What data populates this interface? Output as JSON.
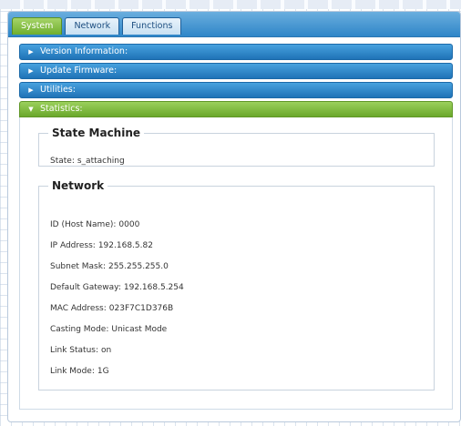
{
  "tabs": [
    {
      "label": "System",
      "active": true
    },
    {
      "label": "Network",
      "active": false
    },
    {
      "label": "Functions",
      "active": false
    }
  ],
  "accordion": [
    {
      "label": "Version Information:",
      "expanded": false,
      "icon": "triangle-right-icon"
    },
    {
      "label": "Update Firmware:",
      "expanded": false,
      "icon": "triangle-right-icon"
    },
    {
      "label": "Utilities:",
      "expanded": false,
      "icon": "triangle-right-icon"
    },
    {
      "label": "Statistics:",
      "expanded": true,
      "icon": "triangle-down-icon"
    }
  ],
  "statistics": {
    "state_machine": {
      "title": "State Machine",
      "state_label": "State:",
      "state_value": "s_attaching"
    },
    "network": {
      "title": "Network",
      "rows": [
        {
          "label": "ID (Host Name):",
          "value": "0000"
        },
        {
          "label": "IP Address:",
          "value": "192.168.5.82"
        },
        {
          "label": "Subnet Mask:",
          "value": "255.255.255.0"
        },
        {
          "label": "Default Gateway:",
          "value": "192.168.5.254"
        },
        {
          "label": "MAC Address:",
          "value": "023F7C1D376B"
        },
        {
          "label": "Casting Mode:",
          "value": "Unicast Mode"
        },
        {
          "label": "Link Status:",
          "value": "on"
        },
        {
          "label": "Link Mode:",
          "value": "1G"
        }
      ]
    }
  },
  "colors": {
    "tab_active": "#7ab83a",
    "tab_bar": "#2f86c8",
    "accordion_blue": "#1f73b7",
    "accordion_green": "#6aa82b"
  }
}
